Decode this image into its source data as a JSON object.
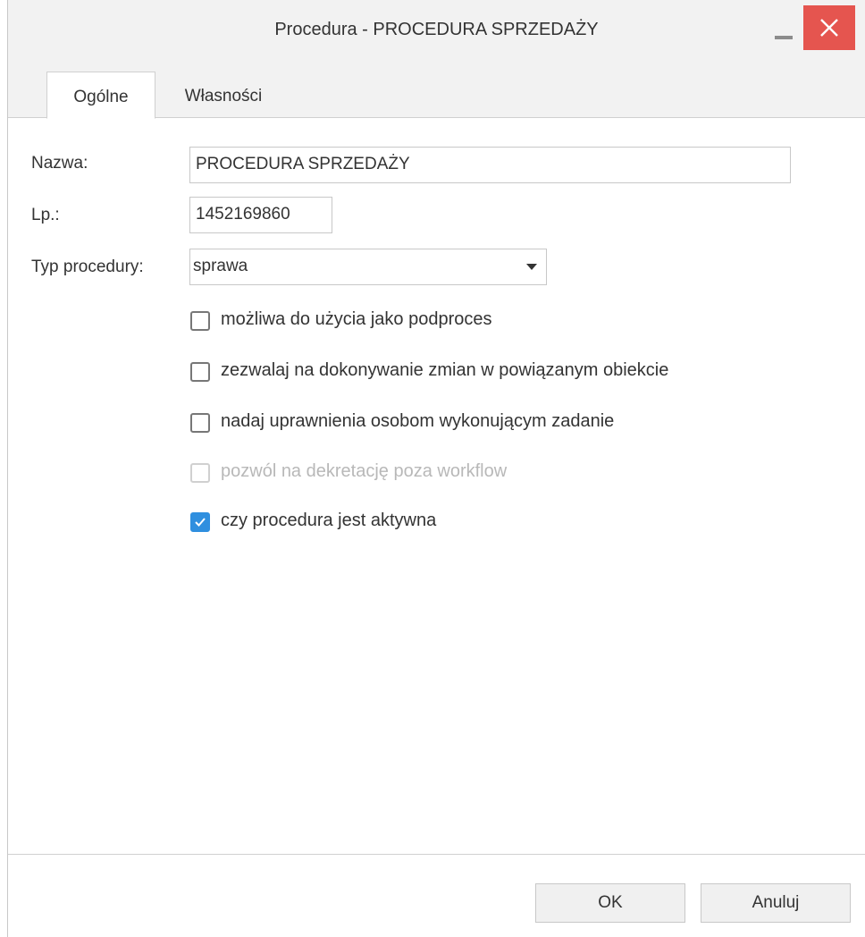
{
  "window": {
    "title": "Procedura - PROCEDURA SPRZEDAŻY",
    "minimize_icon": "minimize-icon",
    "close_icon": "close-icon",
    "close_color": "#e5554f"
  },
  "tabs": [
    {
      "label": "Ogólne",
      "active": true
    },
    {
      "label": "Własności",
      "active": false
    }
  ],
  "form": {
    "name_label": "Nazwa:",
    "name_value": "PROCEDURA SPRZEDAŻY",
    "lp_label": "Lp.:",
    "lp_value": "1452169860",
    "type_label": "Typ procedury:",
    "type_value": "sprawa",
    "checkboxes": [
      {
        "label": "możliwa do użycia jako podproces",
        "checked": false,
        "disabled": false
      },
      {
        "label": "zezwalaj na dokonywanie zmian w powiązanym obiekcie",
        "checked": false,
        "disabled": false
      },
      {
        "label": "nadaj uprawnienia osobom wykonującym zadanie",
        "checked": false,
        "disabled": false
      },
      {
        "label": "pozwól na dekretację poza workflow",
        "checked": false,
        "disabled": true
      },
      {
        "label": "czy procedura jest aktywna",
        "checked": true,
        "disabled": false
      }
    ]
  },
  "buttons": {
    "ok_label": "OK",
    "cancel_label": "Anuluj"
  },
  "colors": {
    "accent": "#2f8fdf",
    "titlebar_bg": "#f2f2f2"
  }
}
